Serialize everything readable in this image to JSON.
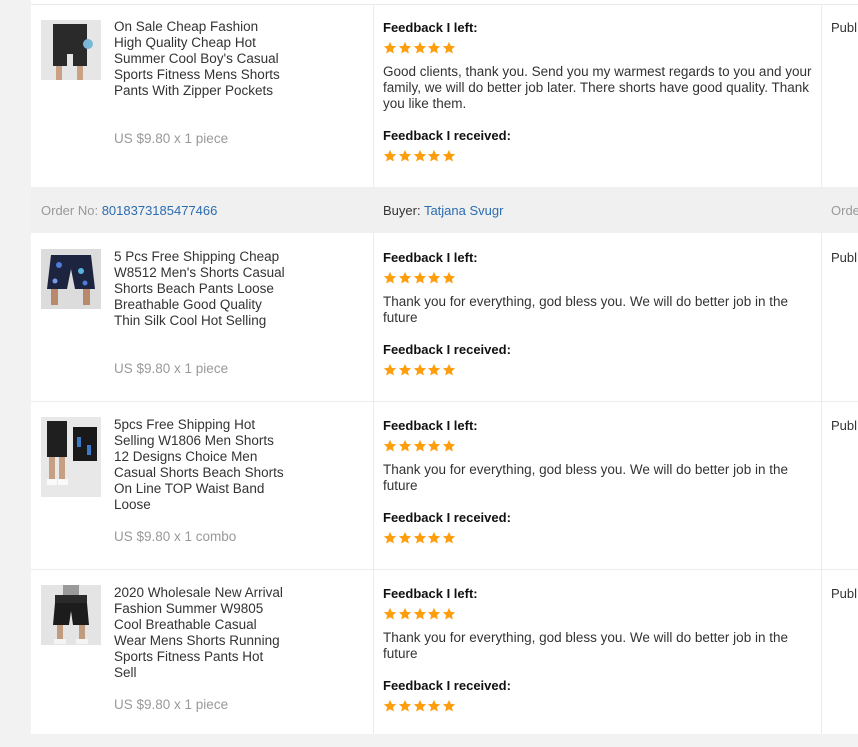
{
  "feedback_rows": [
    {
      "product_title": "On Sale Cheap Fashion High Quality Cheap Hot Summer Cool Boy's Casual Sports Fitness Mens Shorts Pants With Zipper Pockets",
      "price_line": "US $9.80 x 1 piece",
      "left_label": "Feedback I left:",
      "left_stars": 5,
      "left_comment": "Good clients, thank you. Send you my warmest regards to you and your family, we will do better job later. There shorts have good quality. Thank you like them.",
      "received_label": "Feedback I received:",
      "received_stars": 5,
      "status": "Publ",
      "thumb_icon": "shorts-image"
    },
    {
      "product_title": "5 Pcs Free Shipping Cheap W8512 Men's Shorts Casual Shorts Beach Pants Loose Breathable Good Quality Thin Silk Cool Hot Selling",
      "price_line": "US $9.80 x 1 piece",
      "left_label": "Feedback I left:",
      "left_stars": 5,
      "left_comment": "Thank you for everything, god bless you. We will do better job in the future",
      "received_label": "Feedback I received:",
      "received_stars": 5,
      "status": "Publ",
      "thumb_icon": "shorts-image"
    },
    {
      "product_title": "5pcs Free Shipping Hot Selling W1806 Men Shorts 12 Designs Choice Men Casual Shorts Beach Shorts On Line TOP Waist Band Loose",
      "price_line": "US $9.80 x 1 combo",
      "left_label": "Feedback I left:",
      "left_stars": 5,
      "left_comment": "Thank you for everything, god bless you. We will do better job in the future",
      "received_label": "Feedback I received:",
      "received_stars": 5,
      "status": "Publ",
      "thumb_icon": "shorts-image"
    },
    {
      "product_title": "2020 Wholesale New Arrival Fashion Summer W9805 Cool Breathable Casual Wear Mens Shorts Running Sports Fitness Pants Hot Sell",
      "price_line": "US $9.80 x 1 piece",
      "left_label": "Feedback I left:",
      "left_stars": 5,
      "left_comment": "Thank you for everything, god bless you. We will do better job in the future",
      "received_label": "Feedback I received:",
      "received_stars": 5,
      "status": "Publ",
      "thumb_icon": "shorts-image"
    }
  ],
  "order_bar": {
    "order_label": "Order No: ",
    "order_number": "8018373185477466",
    "buyer_label": "Buyer: ",
    "buyer_name": "Tatjana Svugr",
    "cut_text": "Orde"
  },
  "colors": {
    "star": "#ff9e0d",
    "link": "#2b6cb0"
  }
}
